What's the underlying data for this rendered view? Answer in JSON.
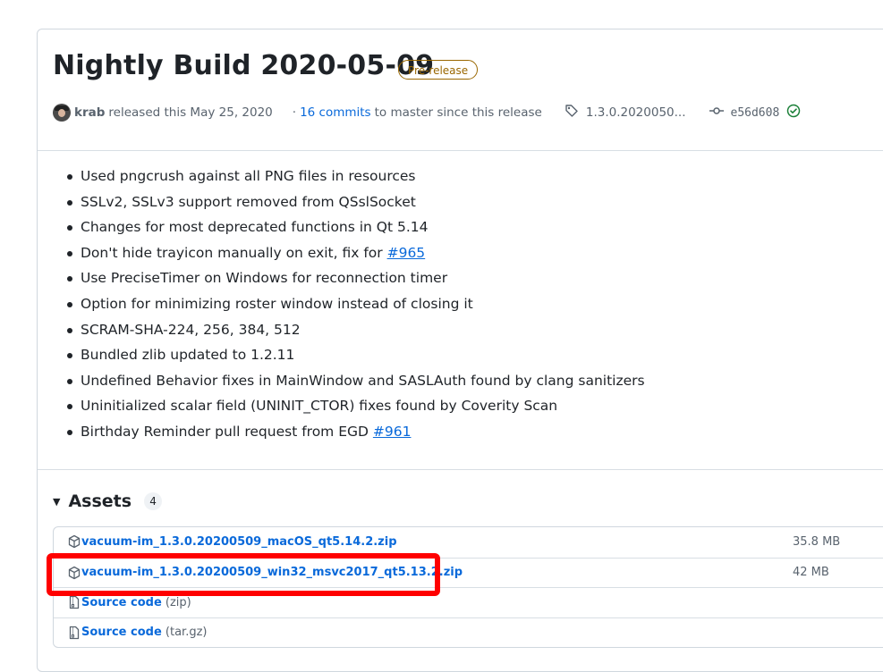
{
  "release": {
    "title": "Nightly Build 2020-05-09",
    "badge": "Pre-release",
    "author": "krab",
    "released_text": "released this May 25, 2020",
    "commits_link": "16 commits",
    "commits_suffix": "to master since this release",
    "tag": "1.3.0.2020050...",
    "commit_sha": "e56d608"
  },
  "notes": [
    {
      "text": "Used pngcrush against all PNG files in resources"
    },
    {
      "text": "SSLv2, SSLv3 support removed from QSslSocket"
    },
    {
      "text": "Changes for most deprecated functions in Qt 5.14"
    },
    {
      "text": "Don't hide trayicon manually on exit, fix for ",
      "link": "#965"
    },
    {
      "text": "Use PreciseTimer on Windows for reconnection timer"
    },
    {
      "text": "Option for minimizing roster window instead of closing it"
    },
    {
      "text": "SCRAM-SHA-224, 256, 384, 512"
    },
    {
      "text": "Bundled zlib updated to 1.2.11"
    },
    {
      "text": "Undefined Behavior fixes in MainWindow and SASLAuth found by clang sanitizers"
    },
    {
      "text": "Uninitialized scalar field (UNINIT_CTOR) fixes found by Coverity Scan"
    },
    {
      "text": "Birthday Reminder pull request from EGD ",
      "link": "#961"
    }
  ],
  "assets": {
    "title": "Assets",
    "count": "4",
    "items": [
      {
        "name": "vacuum-im_1.3.0.20200509_macOS_qt5.14.2.zip",
        "size": "35.8 MB",
        "icon": "package-icon"
      },
      {
        "name": "vacuum-im_1.3.0.20200509_win32_msvc2017_qt5.13.2.zip",
        "size": "42 MB",
        "icon": "package-icon"
      },
      {
        "name": "Source code",
        "suffix": "(zip)",
        "size": "",
        "icon": "file-zip-icon"
      },
      {
        "name": "Source code",
        "suffix": "(tar.gz)",
        "size": "",
        "icon": "file-zip-icon"
      }
    ]
  },
  "colors": {
    "link": "#0969da",
    "badge": "#9a6700",
    "highlight": "#ff0000",
    "verified": "#1a7f37"
  }
}
